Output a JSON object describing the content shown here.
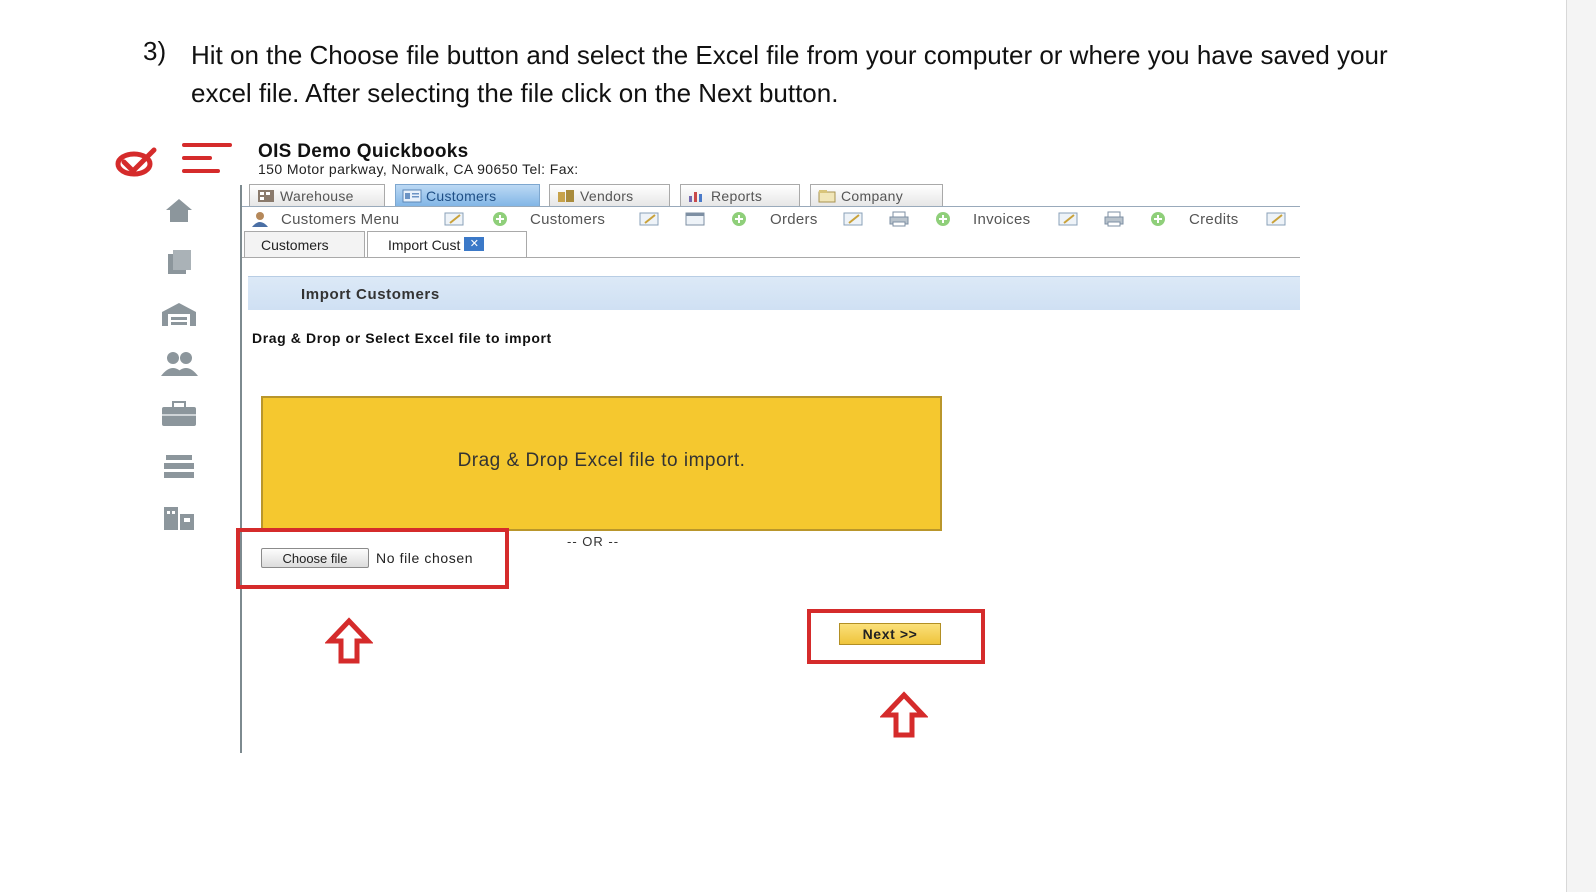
{
  "instruction": {
    "number": "3)",
    "line1": "Hit on the Choose file button and select the Excel file from your computer or where you have saved your",
    "line2": "excel file. After selecting the file click on the Next button."
  },
  "app": {
    "company_name": "OIS Demo Quickbooks",
    "company_address": "150 Motor parkway, Norwalk, CA 90650 Tel: Fax:",
    "accent_color": "#d52b2b",
    "dropzone_color": "#f5c82f"
  },
  "sidebar": {
    "icons": [
      "home-icon",
      "documents-icon",
      "warehouse-icon",
      "users-icon",
      "briefcase-icon",
      "drawer-icon",
      "buildings-icon"
    ]
  },
  "main_tabs": [
    {
      "label": "Warehouse",
      "icon": "warehouse-tab-icon",
      "active": false
    },
    {
      "label": "Customers",
      "icon": "customers-tab-icon",
      "active": true
    },
    {
      "label": "Vendors",
      "icon": "vendors-tab-icon",
      "active": false
    },
    {
      "label": "Reports",
      "icon": "reports-tab-icon",
      "active": false
    },
    {
      "label": "Company",
      "icon": "company-tab-icon",
      "active": false
    }
  ],
  "submenu": {
    "customers_menu": "Customers Menu",
    "customers": "Customers",
    "orders": "Orders",
    "invoices": "Invoices",
    "credits": "Credits"
  },
  "subtabs": {
    "customers": "Customers",
    "import_cust": "Import Cust",
    "close_glyph": "✕"
  },
  "import": {
    "section_title": "Import Customers",
    "instruction": "Drag & Drop or Select Excel file to import",
    "dropzone_text": "Drag & Drop Excel file to import.",
    "or_text": "-- OR --",
    "choose_file_label": "Choose file",
    "no_file_text": "No file chosen",
    "next_label": "Next >>"
  }
}
